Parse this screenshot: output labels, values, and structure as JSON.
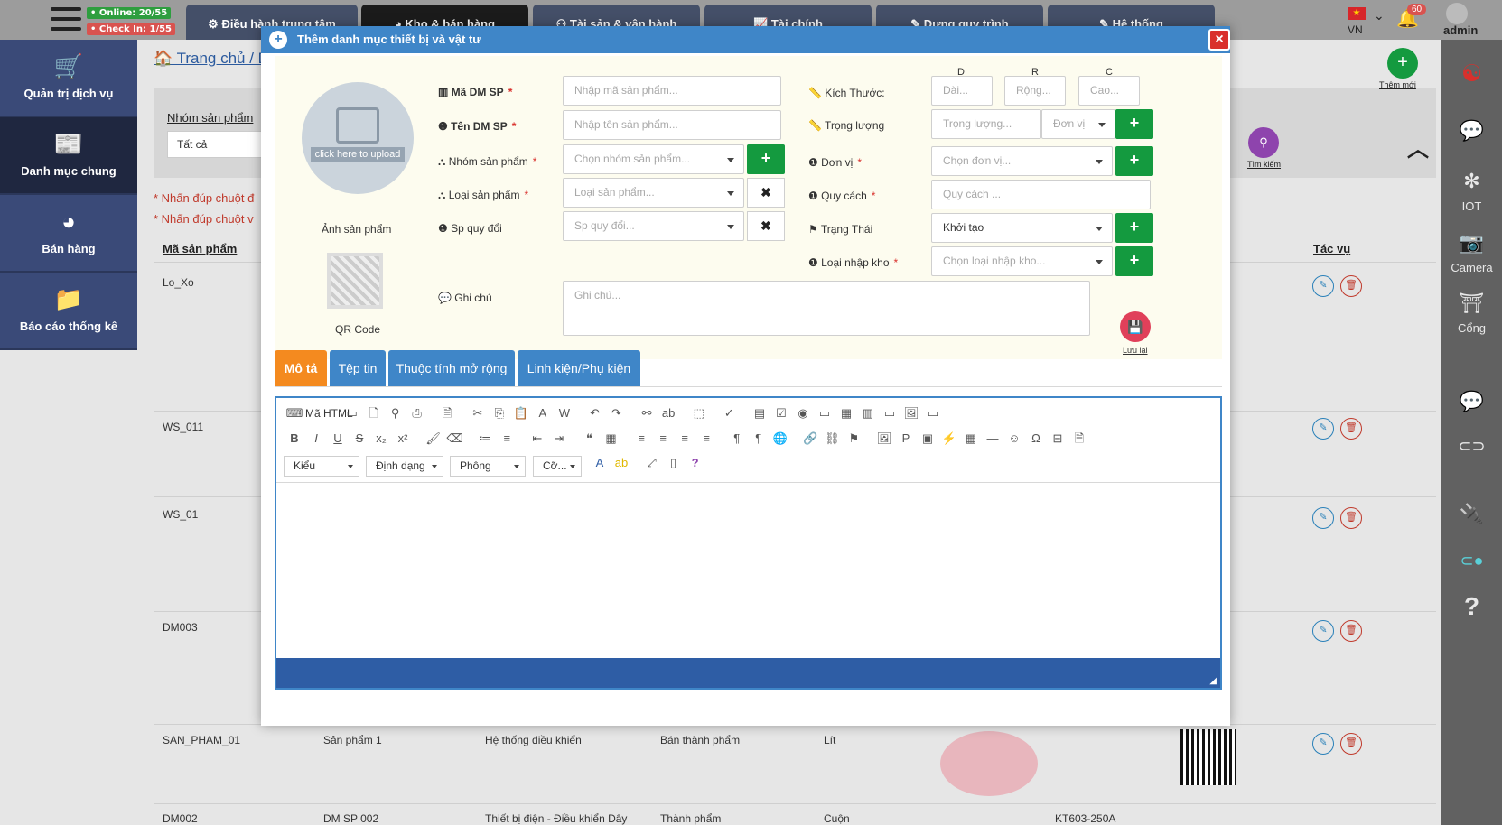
{
  "topbar": {
    "online": "• Online: 20/55",
    "checkin": "• Check In: 1/55",
    "tabs": [
      {
        "label": "⚙ Điều hành trung tâm"
      },
      {
        "label": "◕ Kho & bán hàng"
      },
      {
        "label": "⚇ Tài sản & vận hành"
      },
      {
        "label": "📈 Tài chính"
      },
      {
        "label": "✎ Dựng quy trình"
      },
      {
        "label": "✎ Hệ thống"
      }
    ],
    "lang": "VN",
    "notif_count": "60",
    "user": "admin"
  },
  "leftnav": [
    {
      "icon": "cart-icon",
      "label": "Quản trị dịch vụ"
    },
    {
      "icon": "newspaper-icon",
      "label": "Danh mục chung"
    },
    {
      "icon": "pie-chart-icon",
      "label": "Bán hàng"
    },
    {
      "icon": "folder-icon",
      "label": "Báo cáo thống kê"
    }
  ],
  "rightbar": {
    "iot": "IOT",
    "camera": "Camera",
    "gate": "Cổng"
  },
  "page": {
    "breadcrumb": "🏠 Trang chủ / D",
    "group_label": "Nhóm sản phẩm",
    "group_value": "Tất cả",
    "note1": "* Nhấn đúp chuột đ",
    "note2": "* Nhấn đúp chuột v",
    "add_new": "Thêm mới",
    "search": "Tìm kiếm",
    "col_code": "Mã sản phẩm",
    "col_actions": "Tác vụ",
    "rows": [
      {
        "code": "Lo_Xo",
        "name": "",
        "group": "",
        "type": "",
        "unit": "",
        "spec": ""
      },
      {
        "code": "WS_011",
        "name": "",
        "group": "",
        "type": "",
        "unit": "",
        "spec": ""
      },
      {
        "code": "WS_01",
        "name": "",
        "group": "",
        "type": "",
        "unit": "",
        "spec": ""
      },
      {
        "code": "DM003",
        "name": "",
        "group": "",
        "type": "",
        "unit": "",
        "spec": ""
      },
      {
        "code": "SAN_PHAM_01",
        "name": "Sản phẩm 1",
        "group": "Hệ thống điều khiển",
        "type": "Bán thành phẩm",
        "unit": "Lít",
        "spec": ""
      },
      {
        "code": "DM002",
        "name": "DM SP 002",
        "group": "Thiết bị điện - Điều khiển Dây",
        "type": "Thành phẩm",
        "unit": "Cuộn",
        "spec": "KT603-250A"
      }
    ]
  },
  "modal": {
    "title": "Thêm danh mục thiết bị và vật tư",
    "photo_label": "Ảnh sản phẩm",
    "upload_text": "click here to upload",
    "qr_label": "QR Code",
    "fields": {
      "code_label": "▥ Mã DM SP",
      "code_ph": "Nhập mã sản phẩm...",
      "name_label": "❶ Tên DM SP",
      "name_ph": "Nhập tên sản phẩm...",
      "group_label": "⛬ Nhóm sản phẩm",
      "group_ph": "Chọn nhóm sản phẩm...",
      "type_label": "⛬ Loại sản phẩm",
      "type_ph": "Loại sản phẩm...",
      "convert_label": "❶ Sp quy đổi",
      "convert_ph": "Sp quy đổi...",
      "note_label": "💬 Ghi chú",
      "note_ph": "Ghi chú...",
      "size_label": "📏 Kích Thước:",
      "dim_d": "D",
      "dim_r": "R",
      "dim_c": "C",
      "len_ph": "Dài...",
      "wid_ph": "Rộng...",
      "hei_ph": "Cao...",
      "weight_label": "📏 Trọng lượng",
      "weight_ph": "Trọng lượng...",
      "weight_unit_ph": "Đơn vị",
      "unit_label": "❶ Đơn vị",
      "unit_ph": "Chọn đơn vị...",
      "spec_label": "❶ Quy cách",
      "spec_ph": "Quy cách ...",
      "status_label": "⚑ Trạng Thái",
      "status_value": "Khởi tạo",
      "import_label": "❶ Loại nhập kho",
      "import_ph": "Chọn loại nhập kho..."
    },
    "save_label": "Lưu lại",
    "tabs": [
      "Mô tả",
      "Tệp tin",
      "Thuộc tính mở rộng",
      "Linh kiện/Phụ kiện"
    ],
    "editor": {
      "html_btn": "Mã HTML",
      "style": "Kiểu",
      "format": "Định dạng",
      "font": "Phông",
      "size": "Cỡ..."
    }
  }
}
